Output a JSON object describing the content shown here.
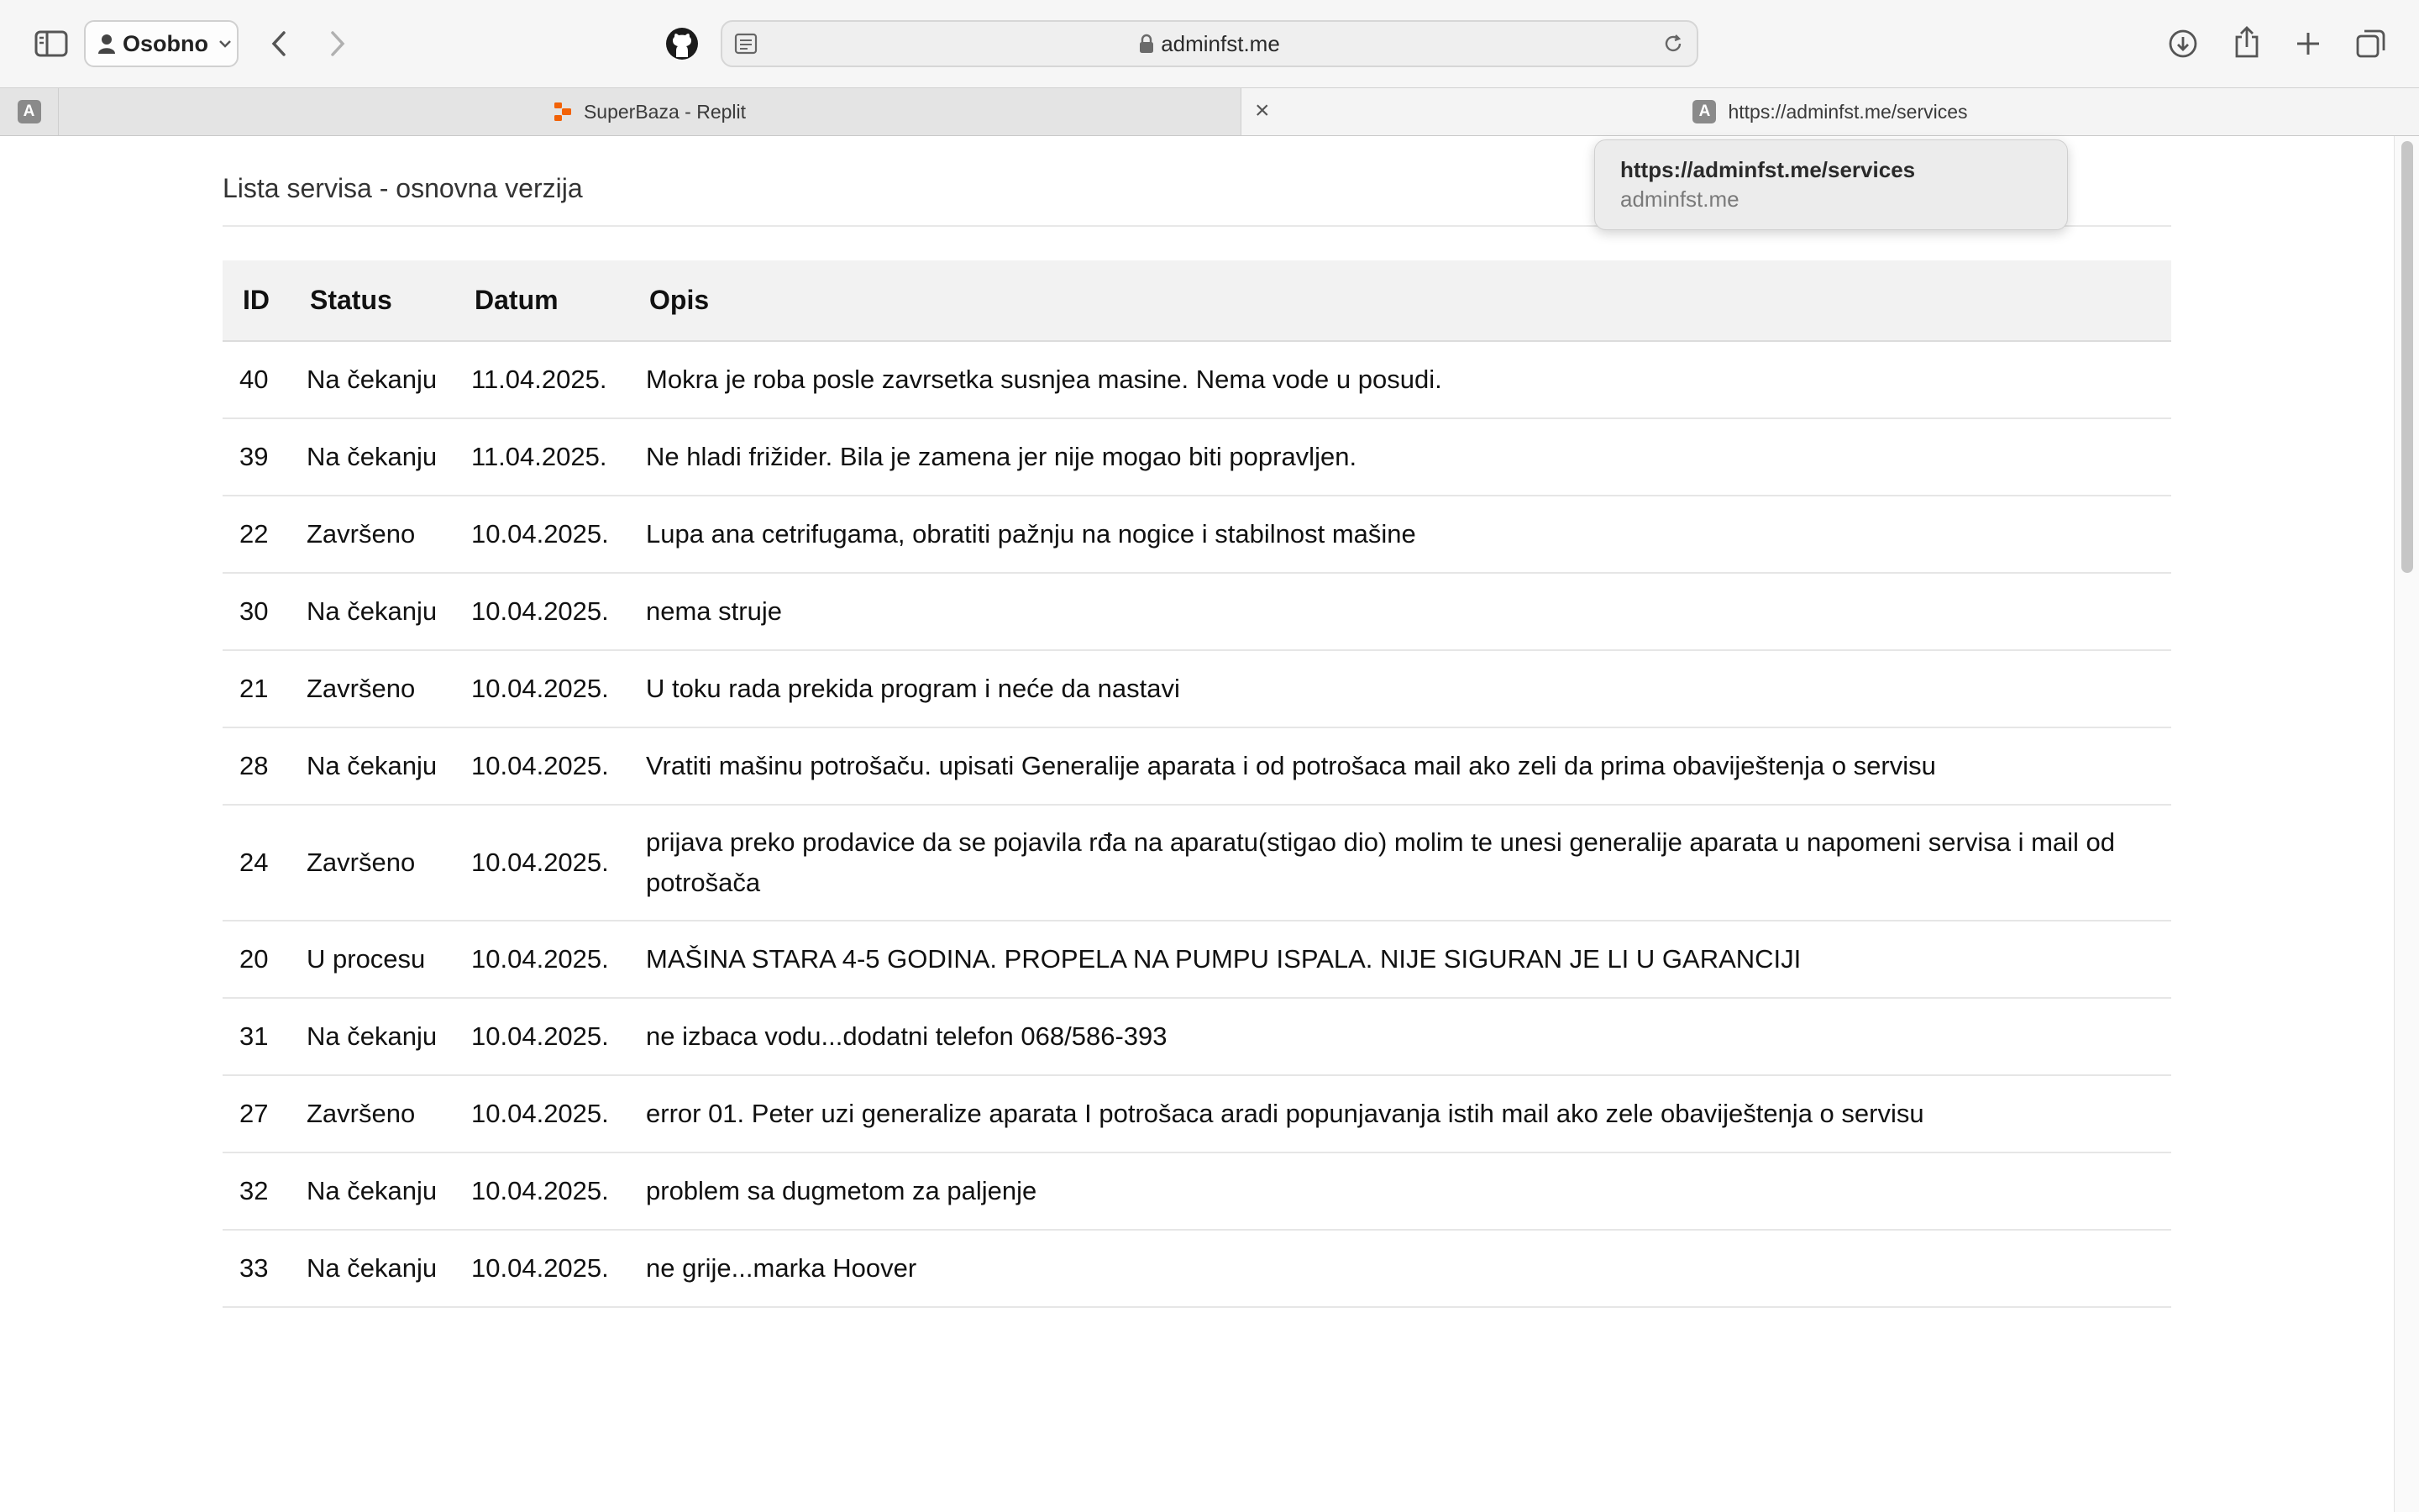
{
  "browser": {
    "profile_label": "Osobno",
    "address": "adminfst.me"
  },
  "tabs": [
    {
      "label": "SuperBaza - Replit"
    },
    {
      "label": "https://adminfst.me/services",
      "close_glyph": "×"
    }
  ],
  "pinned_tab": {
    "favicon_letter": "A"
  },
  "tooltip": {
    "url": "https://adminfst.me/services",
    "host": "adminfst.me"
  },
  "page": {
    "title": "Lista servisa - osnovna verzija",
    "columns": [
      "ID",
      "Status",
      "Datum",
      "Opis"
    ],
    "rows": [
      {
        "id": "40",
        "status": "Na čekanju",
        "date": "11.04.2025.",
        "desc": "Mokra je roba posle zavrsetka susnjea masine. Nema vode u posudi."
      },
      {
        "id": "39",
        "status": "Na čekanju",
        "date": "11.04.2025.",
        "desc": "Ne hladi frižider. Bila je zamena jer nije mogao biti popravljen."
      },
      {
        "id": "22",
        "status": "Završeno",
        "date": "10.04.2025.",
        "desc": "Lupa ana cetrifugama, obratiti pažnju na nogice i stabilnost mašine"
      },
      {
        "id": "30",
        "status": "Na čekanju",
        "date": "10.04.2025.",
        "desc": "nema struje"
      },
      {
        "id": "21",
        "status": "Završeno",
        "date": "10.04.2025.",
        "desc": "U toku rada prekida program i neće da nastavi"
      },
      {
        "id": "28",
        "status": "Na čekanju",
        "date": "10.04.2025.",
        "desc": "Vratiti mašinu potrošaču. upisati Generalije aparata i od potrošaca mail ako zeli da prima obaviještenja o servisu"
      },
      {
        "id": "24",
        "status": "Završeno",
        "date": "10.04.2025.",
        "desc": "prijava preko prodavice da se pojavila rđa na aparatu(stigao dio) molim te unesi generalije aparata u napomeni servisa i mail od potrošača"
      },
      {
        "id": "20",
        "status": "U procesu",
        "date": "10.04.2025.",
        "desc": "MAŠINA STARA 4-5 GODINA. PROPELA NA PUMPU ISPALA. NIJE SIGURAN JE LI U GARANCIJI"
      },
      {
        "id": "31",
        "status": "Na čekanju",
        "date": "10.04.2025.",
        "desc": "ne izbaca vodu...dodatni telefon 068/586-393"
      },
      {
        "id": "27",
        "status": "Završeno",
        "date": "10.04.2025.",
        "desc": "error 01. Peter uzi generalize aparata I potrošaca aradi popunjavanja istih mail ako zele obaviještenja o servisu"
      },
      {
        "id": "32",
        "status": "Na čekanju",
        "date": "10.04.2025.",
        "desc": "problem sa dugmetom za paljenje"
      },
      {
        "id": "33",
        "status": "Na čekanju",
        "date": "10.04.2025.",
        "desc": "ne grije...marka Hoover"
      }
    ]
  },
  "icons": {
    "sidebar": "sidebar-icon",
    "back": "chevron-left-icon",
    "forward": "chevron-right-icon",
    "github": "github-icon",
    "reader": "reader-icon",
    "reload": "reload-icon",
    "download": "download-icon",
    "share": "share-icon",
    "new_tab": "plus-icon",
    "tabs_overview": "tabs-icon"
  }
}
